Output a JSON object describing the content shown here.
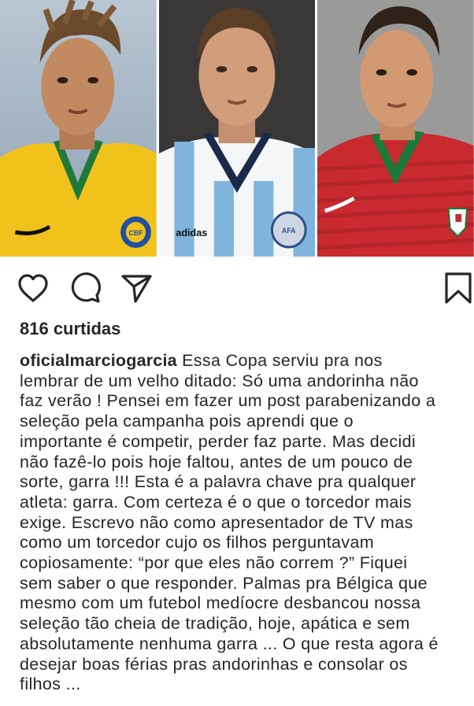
{
  "post": {
    "photos": [
      {
        "kit": "brazil-yellow",
        "crest": "CBF"
      },
      {
        "kit": "argentina-striped",
        "brand": "adidas",
        "crest": "AFA"
      },
      {
        "kit": "portugal-red"
      }
    ],
    "actions": {
      "like_icon": "heart-icon",
      "comment_icon": "comment-icon",
      "share_icon": "send-icon",
      "save_icon": "bookmark-icon"
    },
    "likes_text": "816 curtidas",
    "caption": {
      "username": "oficialmarciogarcia",
      "lines": [
        " Essa Copa serviu pra nos",
        "lembrar de um velho ditado: Só uma andorinha não",
        "faz verão ! Pensei em fazer um post parabenizando a",
        "seleção pela campanha pois aprendi que o",
        "importante é competir, perder faz parte. Mas decidi",
        "não fazê-lo pois hoje faltou, antes de um pouco de",
        "sorte, garra !!! Esta é a palavra chave pra qualquer",
        "atleta: garra. Com certeza é o que o torcedor mais",
        "exige. Escrevo não como apresentador de TV mas",
        "como um torcedor cujo os filhos perguntavam",
        "copiosamente: “por que eles não correm ?” Fiquei",
        "sem saber o que responder. Palmas pra Bélgica que",
        "mesmo com um futebol medíocre desbancou nossa",
        "seleção tão cheia de tradição, hoje, apática e sem",
        "absolutamente nenhuma garra ... O que resta agora é",
        "desejar boas férias pras andorinhas e consolar os",
        "filhos ..."
      ]
    }
  }
}
